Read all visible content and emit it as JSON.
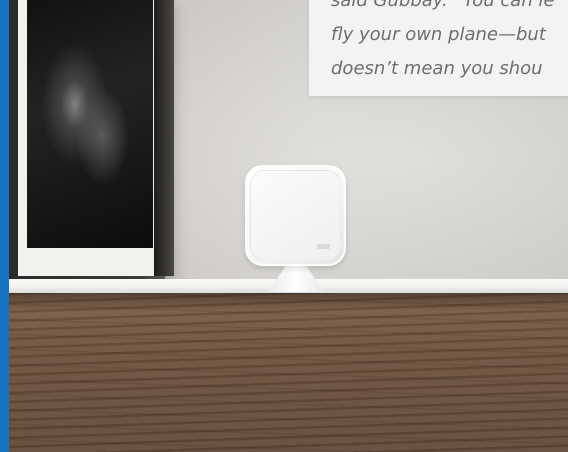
{
  "quote": {
    "lines": [
      "said Gubbay. “You can le",
      "fly your own plane—but",
      "doesn’t mean you shou"
    ]
  },
  "colors": {
    "accent_bar": "#1474c3",
    "quote_text": "#6e6e6e",
    "quote_card": "#f3f3f3",
    "wood": "#6b513d"
  }
}
